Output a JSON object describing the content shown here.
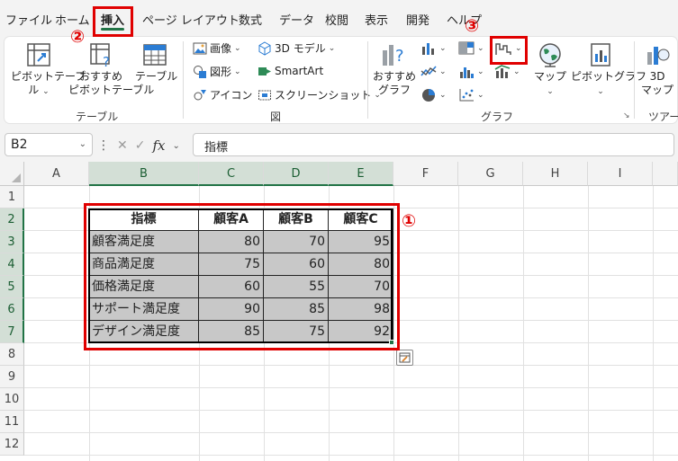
{
  "menu": {
    "tabs": [
      "ファイル",
      "ホーム",
      "挿入",
      "ページ レイアウト",
      "数式",
      "データ",
      "校閲",
      "表示",
      "開発",
      "ヘルプ"
    ],
    "active_tab": "挿入"
  },
  "ribbon": {
    "tables": {
      "pivot_table": [
        "ピボットテーブ",
        "ル"
      ],
      "recommended_pivot": [
        "おすすめ",
        "ピボットテーブル"
      ],
      "table": "テーブル",
      "group_label": "テーブル"
    },
    "illustrations": {
      "image": "画像",
      "shapes": "図形",
      "icons": "アイコン",
      "model3d": "3D モデル",
      "smartart": "SmartArt",
      "screenshot": "スクリーンショット",
      "group_label": "図"
    },
    "charts": {
      "recommended": [
        "おすすめ",
        "グラフ"
      ],
      "maps": "マップ",
      "pivot_chart": "ピボットグラフ",
      "group_label": "グラフ"
    },
    "tours": {
      "map3d": [
        "3D",
        "マップ"
      ],
      "group_label": "ツアー"
    }
  },
  "formula_bar": {
    "name_box": "B2",
    "fx": "fx",
    "content": "指標"
  },
  "sheet": {
    "columns": [
      "A",
      "B",
      "C",
      "D",
      "E",
      "F",
      "G",
      "H",
      "I"
    ],
    "rows": [
      "1",
      "2",
      "3",
      "4",
      "5",
      "6",
      "7",
      "8",
      "9",
      "10",
      "11",
      "12"
    ],
    "table": {
      "headers": [
        "指標",
        "顧客A",
        "顧客B",
        "顧客C"
      ],
      "rows": [
        [
          "顧客満足度",
          "80",
          "70",
          "95"
        ],
        [
          "商品満足度",
          "75",
          "60",
          "80"
        ],
        [
          "価格満足度",
          "60",
          "55",
          "70"
        ],
        [
          "サポート満足度",
          "90",
          "85",
          "98"
        ],
        [
          "デザイン満足度",
          "85",
          "75",
          "92"
        ]
      ]
    }
  },
  "annotations": {
    "step1": "①",
    "step2": "②",
    "step3": "③",
    "color": "#e00000"
  },
  "colors": {
    "accent_green": "#217346",
    "table_fill": "#c8c8c8",
    "annotation_red": "#e00000"
  }
}
